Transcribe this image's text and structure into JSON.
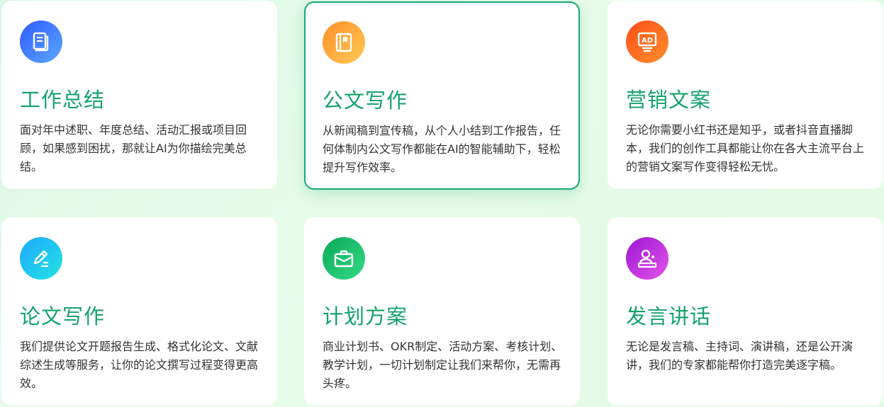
{
  "cards": [
    {
      "title": "工作总结",
      "desc": "面对年中述职、年度总结、活动汇报或项目回顾，如果感到困扰，那就让AI为你描绘完美总结。",
      "icon": "document-icon",
      "gradient": [
        "#2f6bff",
        "#5aa0ff"
      ],
      "active": false
    },
    {
      "title": "公文写作",
      "desc": "从新闻稿到宣传稿，从个人小结到工作报告，任何体制内公文写作都能在AI的智能辅助下，轻松提升写作效率。",
      "icon": "book-icon",
      "gradient": [
        "#ff9a2e",
        "#ffc44d"
      ],
      "active": true
    },
    {
      "title": "营销文案",
      "desc": "无论你需要小红书还是知乎，或者抖音直播脚本，我们的创作工具都能让你在各大主流平台上的营销文案写作变得轻松无忧。",
      "icon": "ad-icon",
      "gradient": [
        "#ff5a1f",
        "#ff8a2a"
      ],
      "active": false
    },
    {
      "title": "论文写作",
      "desc": "我们提供论文开题报告生成、格式化论文、文献综述生成等服务，让你的论文撰写过程变得更高效。",
      "icon": "pen-icon",
      "gradient": [
        "#1fb5ff",
        "#21e0e6"
      ],
      "active": false
    },
    {
      "title": "计划方案",
      "desc": "商业计划书、OKR制定、活动方案、考核计划、教学计划，一切计划制定让我们来帮你，无需再头疼。",
      "icon": "briefcase-icon",
      "gradient": [
        "#0fb35f",
        "#2fd883"
      ],
      "active": false
    },
    {
      "title": "发言讲话",
      "desc": "无论是发言稿、主持词、演讲稿，还是公开演讲，我们的专家都能帮你打造完美逐字稿。",
      "icon": "speaker-icon",
      "gradient": [
        "#a21fd6",
        "#e04ae3"
      ],
      "active": false
    }
  ]
}
